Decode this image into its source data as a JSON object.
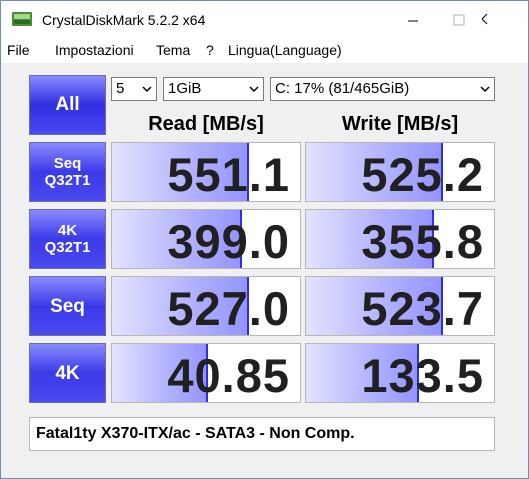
{
  "window": {
    "title": "CrystalDiskMark 5.2.2 x64"
  },
  "menu": [
    "File",
    "Impostazioni",
    "Tema",
    "?",
    "Lingua(Language)"
  ],
  "controls": {
    "all_label": "All",
    "count": "5",
    "size": "1GiB",
    "drive": "C: 17% (81/465GiB)"
  },
  "headers": {
    "read": "Read [MB/s]",
    "write": "Write [MB/s]"
  },
  "rows": [
    {
      "label_line1": "Seq",
      "label_line2": "Q32T1",
      "read": "551.1",
      "write": "525.2",
      "read_level": 0.73,
      "write_level": 0.73
    },
    {
      "label_line1": "4K",
      "label_line2": "Q32T1",
      "read": "399.0",
      "write": "355.8",
      "read_level": 0.69,
      "write_level": 0.68
    },
    {
      "label_line1": "Seq",
      "label_line2": "",
      "read": "527.0",
      "write": "523.7",
      "read_level": 0.73,
      "write_level": 0.73
    },
    {
      "label_line1": "4K",
      "label_line2": "",
      "read": "40.85",
      "write": "133.5",
      "read_level": 0.51,
      "write_level": 0.6
    }
  ],
  "comment": "Fatal1ty X370-ITX/ac - SATA3 - Non Comp.",
  "colors": {
    "button_blue": "#3a3ae8",
    "bar_blue": "#9393ff"
  }
}
